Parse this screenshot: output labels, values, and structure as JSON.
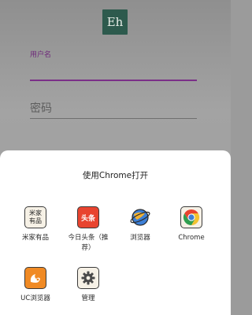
{
  "login": {
    "logo_text": "Eh",
    "username_label": "用户名",
    "password_label": "密码"
  },
  "share_sheet": {
    "title": "使用Chrome打开",
    "apps": [
      {
        "label": "米家有品",
        "icon_text": "米家有品",
        "icon": "mijia-youpin-icon"
      },
      {
        "label": "今日头条（推荐）",
        "icon_text": "头条",
        "icon": "toutiao-icon"
      },
      {
        "label": "浏览器",
        "icon": "browser-icon"
      },
      {
        "label": "Chrome",
        "icon": "chrome-icon"
      },
      {
        "label": "UC浏览器",
        "icon": "uc-browser-icon"
      },
      {
        "label": "管理",
        "icon": "gear-icon"
      }
    ]
  },
  "colors": {
    "accent": "#7b2f88",
    "logo_bg": "#2d5a4d",
    "toutiao_red": "#e8442f"
  }
}
